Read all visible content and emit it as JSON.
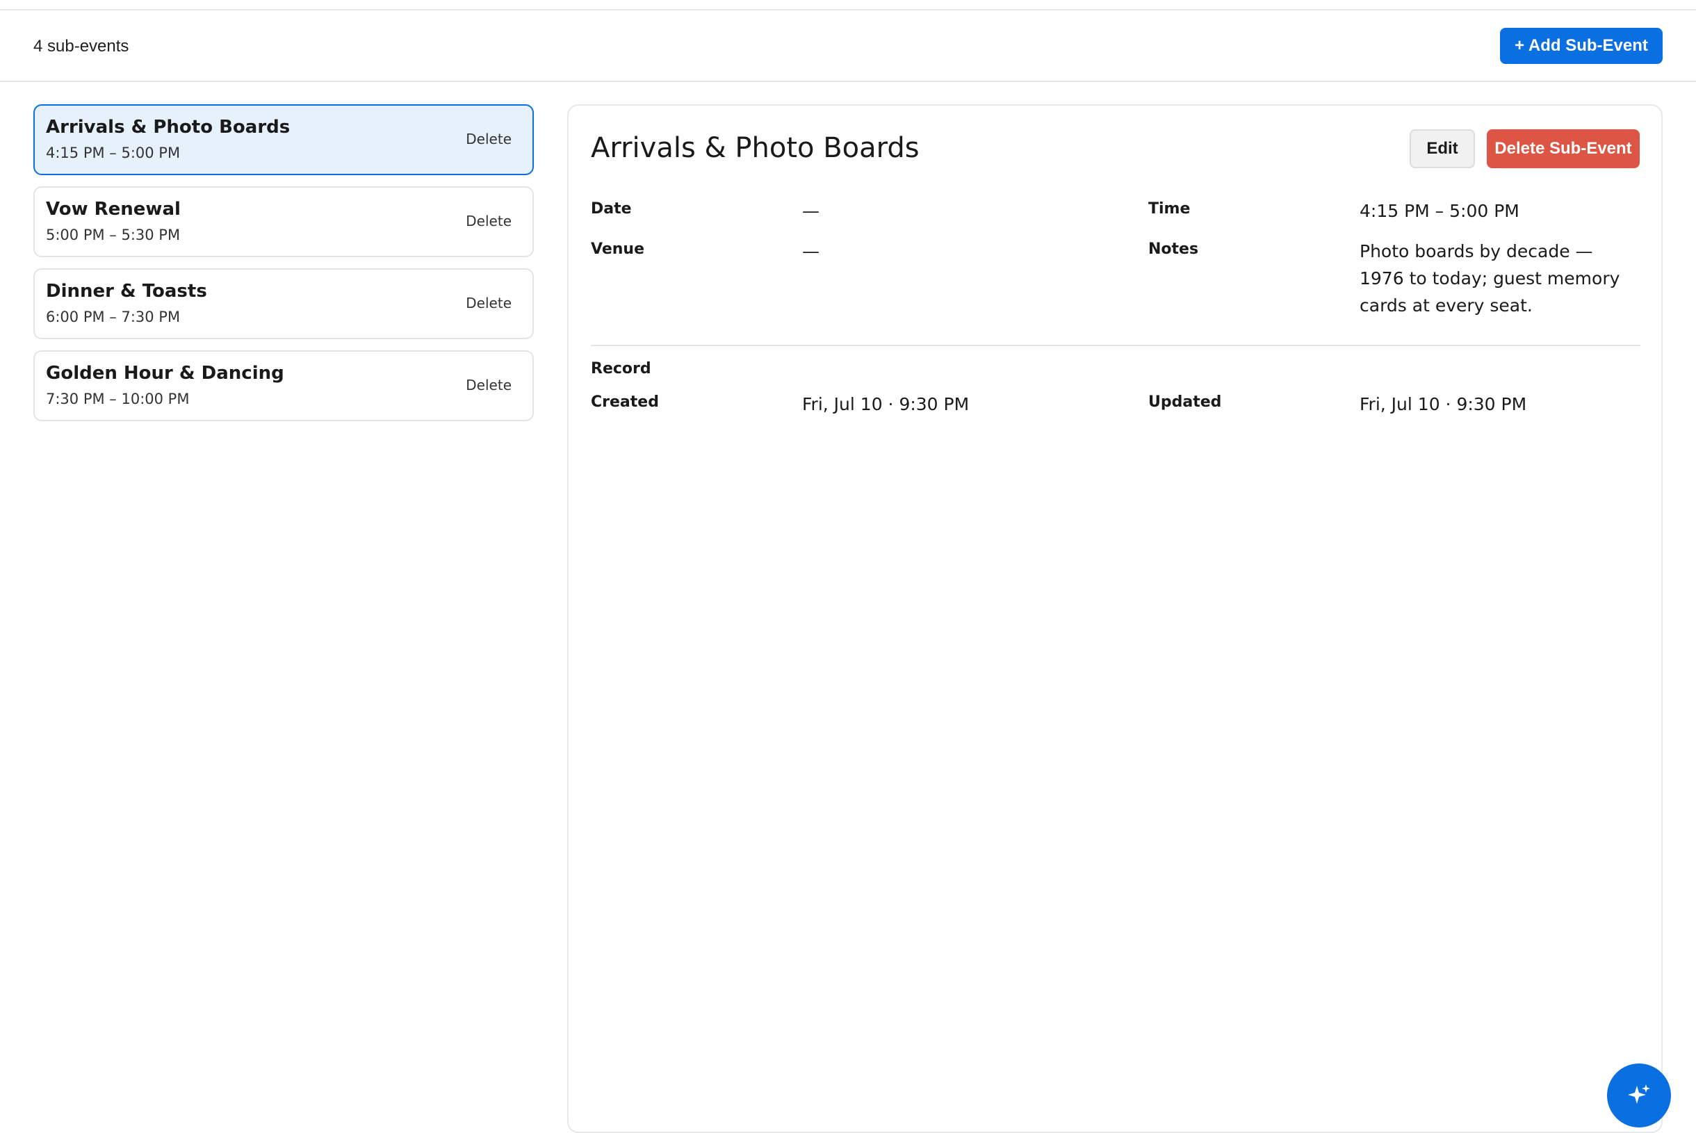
{
  "toolbar": {
    "count_label": "4 sub-events",
    "add_button_label": "+ Add Sub-Event"
  },
  "list": {
    "items": [
      {
        "title": "Arrivals & Photo Boards",
        "time": "4:15 PM – 5:00 PM",
        "delete_label": "Delete",
        "selected": true
      },
      {
        "title": "Vow Renewal",
        "time": "5:00 PM – 5:30 PM",
        "delete_label": "Delete",
        "selected": false
      },
      {
        "title": "Dinner & Toasts",
        "time": "6:00 PM – 7:30 PM",
        "delete_label": "Delete",
        "selected": false
      },
      {
        "title": "Golden Hour & Dancing",
        "time": "7:30 PM – 10:00 PM",
        "delete_label": "Delete",
        "selected": false
      }
    ]
  },
  "detail": {
    "title": "Arrivals & Photo Boards",
    "edit_label": "Edit",
    "delete_label": "Delete Sub-Event",
    "fields": {
      "date_label": "Date",
      "date_value": "—",
      "time_label": "Time",
      "time_value": "4:15 PM – 5:00 PM",
      "venue_label": "Venue",
      "venue_value": "—",
      "notes_label": "Notes",
      "notes_value": "Photo boards by decade — 1976 to today; guest memory cards at every seat."
    },
    "record": {
      "section_label": "Record",
      "created_label": "Created",
      "created_value": "Fri, Jul 10 · 9:30 PM",
      "updated_label": "Updated",
      "updated_value": "Fri, Jul 10 · 9:30 PM"
    }
  },
  "fab": {
    "icon": "sparkle-icon"
  },
  "colors": {
    "accent": "#0a6fe0",
    "selected_bg": "#e6f1fc",
    "danger": "#dd5544"
  }
}
